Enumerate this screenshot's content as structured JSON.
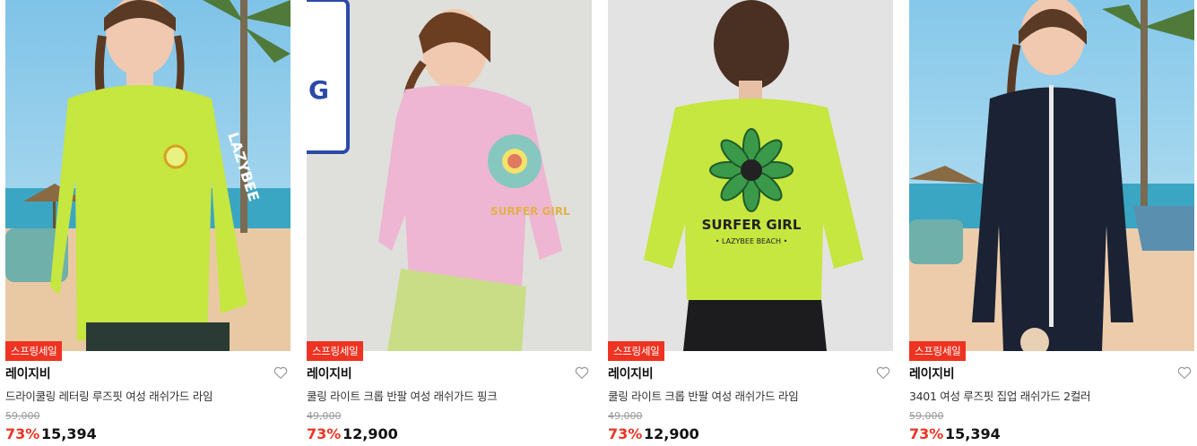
{
  "products": [
    {
      "badge": "스프링세일",
      "brand": "레이지비",
      "name": "드라이쿨링 레터링 루즈핏 여성 래쉬가드 라임",
      "original_price": "59,000",
      "discount": "73%",
      "price": "15,394",
      "wishlist_icon": "heart-outline-icon"
    },
    {
      "badge": "스프링세일",
      "brand": "레이지비",
      "name": "쿨링 라이트 크롭 반팔 여성 래쉬가드 핑크",
      "original_price": "49,000",
      "discount": "73%",
      "price": "12,900",
      "wishlist_icon": "heart-outline-icon"
    },
    {
      "badge": "스프링세일",
      "brand": "레이지비",
      "name": "쿨링 라이트 크롭 반팔 여성 래쉬가드 라임",
      "original_price": "49,000",
      "discount": "73%",
      "price": "12,900",
      "wishlist_icon": "heart-outline-icon"
    },
    {
      "badge": "스프링세일",
      "brand": "레이지비",
      "name": "3401 여성 루즈핏 집업 래쉬가드 2컬러",
      "original_price": "59,000",
      "discount": "73%",
      "price": "15,394",
      "wishlist_icon": "heart-outline-icon"
    }
  ],
  "image_text": {
    "card1_print": "LAZYBEE",
    "card2_sign": "G",
    "card2_print": "SURFER GIRL",
    "card3_print": "SURFER GIRL",
    "card3_sub": "• LAZYBEE BEACH •"
  },
  "colors": {
    "accent_red": "#ee3322",
    "lime": "#c6e640",
    "pink": "#eeb6d2",
    "navy": "#1a2233"
  }
}
